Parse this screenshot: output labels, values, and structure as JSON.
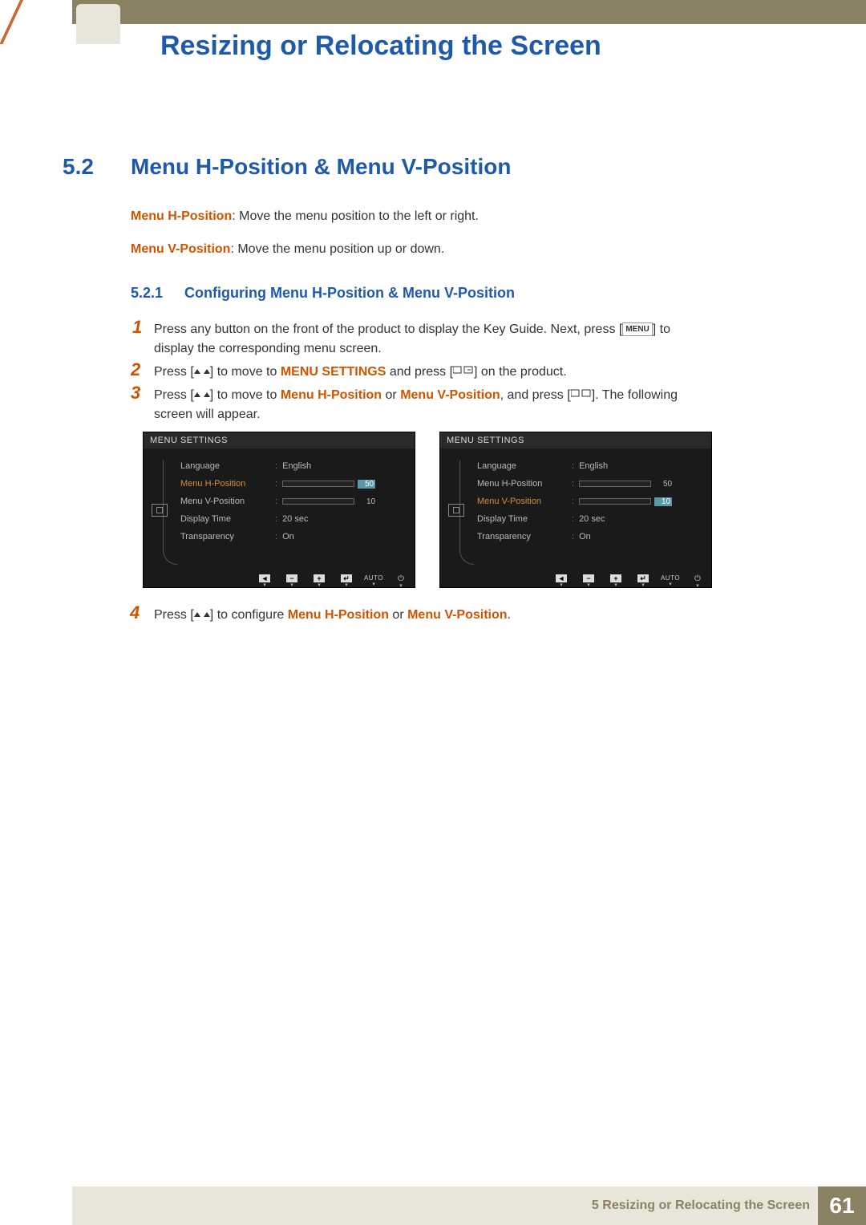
{
  "header": {
    "title": "Resizing or Relocating the Screen"
  },
  "section": {
    "number": "5.2",
    "title": "Menu H-Position & Menu V-Position"
  },
  "desc": {
    "h_label": "Menu H-Position",
    "h_text": ": Move the menu position to the left or right.",
    "v_label": "Menu V-Position",
    "v_text": ": Move the menu position up or down."
  },
  "subsection": {
    "number": "5.2.1",
    "title": "Configuring Menu H-Position & Menu V-Position"
  },
  "steps": {
    "s1": {
      "num": "1",
      "pre": "Press any button on the front of the product to display the Key Guide. Next, press [",
      "menu_label": "MENU",
      "post": "] to display the corresponding menu screen."
    },
    "s2": {
      "num": "2",
      "pre": "Press [",
      "mid": "] to move to ",
      "menu_settings": "MENU SETTINGS",
      "mid2": " and press [",
      "post": "] on the product."
    },
    "s3": {
      "num": "3",
      "pre": "Press [",
      "mid": "] to move to ",
      "opt1": "Menu H-Position",
      "or": " or ",
      "opt2": "Menu V-Position",
      "mid2": ", and press [",
      "post": "]. The following screen will appear."
    },
    "s4": {
      "num": "4",
      "pre": "Press [",
      "mid": "] to configure ",
      "opt1": "Menu H-Position",
      "or": " or ",
      "opt2": "Menu V-Position",
      "post": "."
    }
  },
  "osd": {
    "title": "MENU SETTINGS",
    "labels": {
      "language": "Language",
      "hpos": "Menu H-Position",
      "vpos": "Menu V-Position",
      "dtime": "Display Time",
      "transp": "Transparency"
    },
    "values": {
      "language": "English",
      "hval": "50",
      "vval": "10",
      "dtime": "20 sec",
      "transp": "On"
    },
    "footer": {
      "auto": "AUTO"
    }
  },
  "footer": {
    "chapter_num": "5",
    "chapter_title": " Resizing or Relocating the Screen",
    "page": "61"
  }
}
